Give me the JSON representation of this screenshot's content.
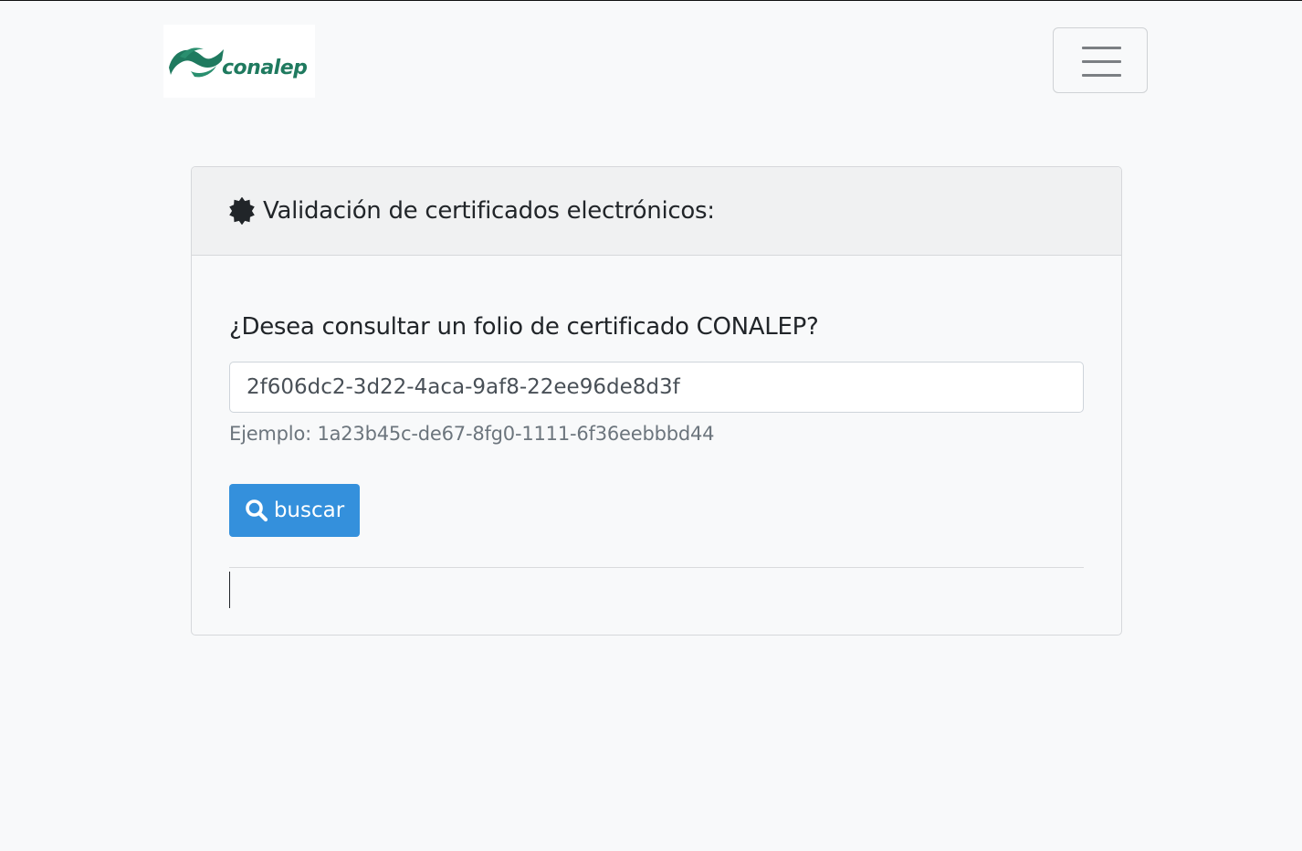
{
  "brand": {
    "logo_text": "conalep",
    "logo_color": "#1f7a5f"
  },
  "nav": {
    "toggler_icon": "hamburger-menu-icon"
  },
  "card": {
    "header_icon": "certificate-badge-icon",
    "title": "Validación de certificados electrónicos:",
    "question": "¿Desea consultar un folio de certificado CONALEP?",
    "folio_value": "2f606dc2-3d22-4aca-9af8-22ee96de8d3f",
    "hint": "Ejemplo: 1a23b45c-de67-8fg0-1111-6f36eebbbd44",
    "search_button_label": "buscar",
    "search_button_icon": "search-icon",
    "button_color": "#3490dc"
  }
}
